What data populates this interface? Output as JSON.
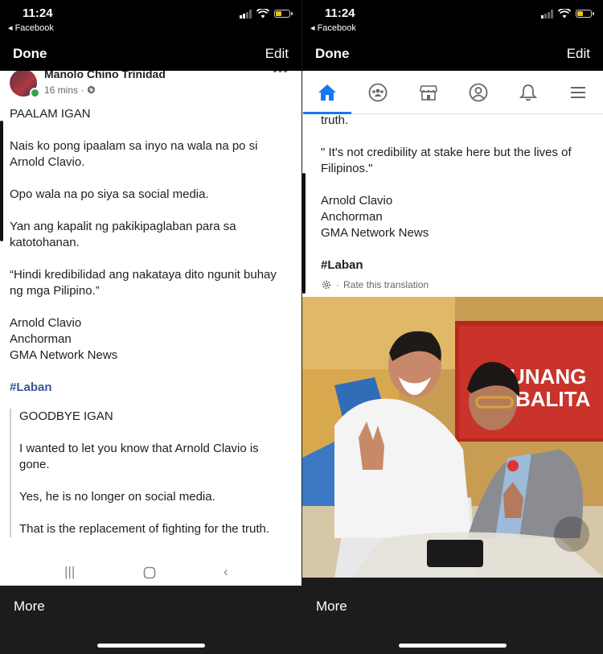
{
  "status": {
    "time": "11:24",
    "back_label": "◂ Facebook"
  },
  "navbar": {
    "done": "Done",
    "edit": "Edit"
  },
  "post": {
    "author": "Manolo Chino Trinidad",
    "meta": "16 mins ·",
    "original": {
      "p1": "PAALAM IGAN",
      "p2": "Nais ko pong ipaalam sa inyo na wala na po si Arnold Clavio.",
      "p3": "Opo wala na po siya sa social media.",
      "p4": "Yan ang kapalit ng pakikipaglaban para sa katotohanan.",
      "p5": "“Hindi kredibilidad ang nakataya dito ngunit buhay ng mga Pilipino.”",
      "sig1": "Arnold Clavio",
      "sig2": "Anchorman",
      "sig3": "GMA Network News",
      "hashtag": "#Laban"
    },
    "translation": {
      "p1": "GOODBYE IGAN",
      "p2": "I wanted to let you know that Arnold Clavio is gone.",
      "p3": "Yes, he is no longer on social media.",
      "p4": "That is the replacement of fighting for the truth.",
      "p4_tail": "truth.",
      "p5": "\" It's not credibility at stake here but the lives of Filipinos.\"",
      "sig1": "Arnold Clavio",
      "sig2": "Anchorman",
      "sig3": "GMA Network News",
      "hashtag": "#Laban",
      "rate": "Rate this translation"
    }
  },
  "photo": {
    "sign_line1": "UNANG",
    "sign_line2": "BALITA"
  },
  "bottom": {
    "more": "More"
  },
  "colors": {
    "accent": "#1877f2",
    "hashtag": "#385898",
    "bar": "#1c1c1e"
  },
  "icons": [
    "home-icon",
    "groups-icon",
    "marketplace-icon",
    "profile-icon",
    "bell-icon",
    "menu-icon"
  ]
}
